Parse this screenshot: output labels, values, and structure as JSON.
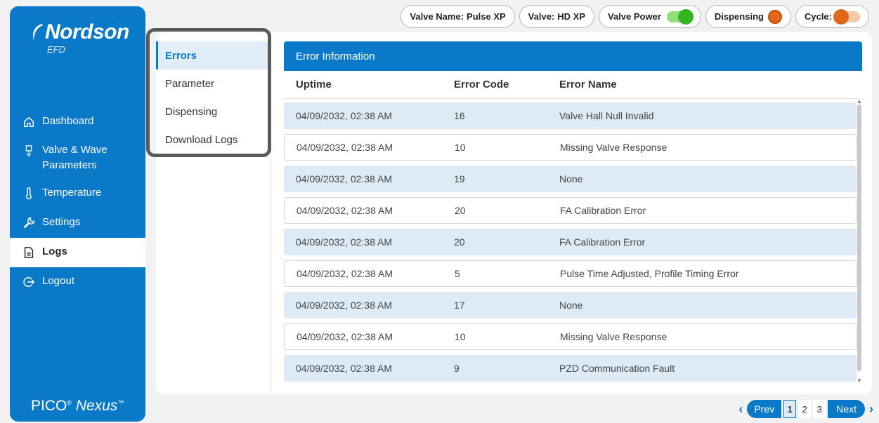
{
  "brand": {
    "logo": "Nordson",
    "logo_sub": "EFD",
    "product_a": "PICO",
    "product_reg": "®",
    "product_b": "Nexus",
    "product_tm": "™"
  },
  "sidebar": {
    "items": [
      {
        "label": "Dashboard",
        "icon": "home-icon"
      },
      {
        "label": "Valve & Wave Parameters",
        "icon": "valve-icon"
      },
      {
        "label": "Temperature",
        "icon": "thermometer-icon"
      },
      {
        "label": "Settings",
        "icon": "wrench-icon"
      },
      {
        "label": "Logs",
        "icon": "document-icon",
        "active": true
      },
      {
        "label": "Logout",
        "icon": "logout-icon"
      }
    ]
  },
  "status": {
    "valve_name_label": "Valve Name:",
    "valve_name_value": "Pulse XP",
    "valve_label": "Valve:",
    "valve_value": "HD XP",
    "valve_power_label": "Valve Power",
    "dispensing_label": "Dispensing",
    "cycle_label": "Cycle:",
    "colors": {
      "power_on": "#35b51f",
      "power_track": "#8fe07a",
      "dispensing": "#e0681a",
      "cycle_knob": "#e0681a",
      "cycle_track": "#f6c8a8"
    }
  },
  "subnav": {
    "items": [
      {
        "label": "Errors",
        "active": true
      },
      {
        "label": "Parameter"
      },
      {
        "label": "Dispensing"
      },
      {
        "label": "Download Logs"
      }
    ]
  },
  "table": {
    "title": "Error Information",
    "columns": [
      "Uptime",
      "Error Code",
      "Error Name"
    ],
    "rows": [
      [
        "04/09/2032, 02:38 AM",
        "16",
        "Valve Hall Null Invalid"
      ],
      [
        "04/09/2032, 02:38 AM",
        "10",
        "Missing Valve Response"
      ],
      [
        "04/09/2032, 02:38 AM",
        "19",
        "None"
      ],
      [
        "04/09/2032, 02:38 AM",
        "20",
        "FA Calibration Error"
      ],
      [
        "04/09/2032, 02:38 AM",
        "20",
        "FA Calibration Error"
      ],
      [
        "04/09/2032, 02:38 AM",
        "5",
        "Pulse Time Adjusted, Profile Timing Error"
      ],
      [
        "04/09/2032, 02:38 AM",
        "17",
        "None"
      ],
      [
        "04/09/2032, 02:38 AM",
        "10",
        "Missing Valve Response"
      ],
      [
        "04/09/2032, 02:38 AM",
        "9",
        "PZD Communication Fault"
      ]
    ]
  },
  "pagination": {
    "prev": "Prev",
    "next": "Next",
    "pages": [
      "1",
      "2",
      "3"
    ],
    "current": "1"
  },
  "theme": {
    "accent": "#0a79c8",
    "row_shade": "#ddebf7"
  }
}
